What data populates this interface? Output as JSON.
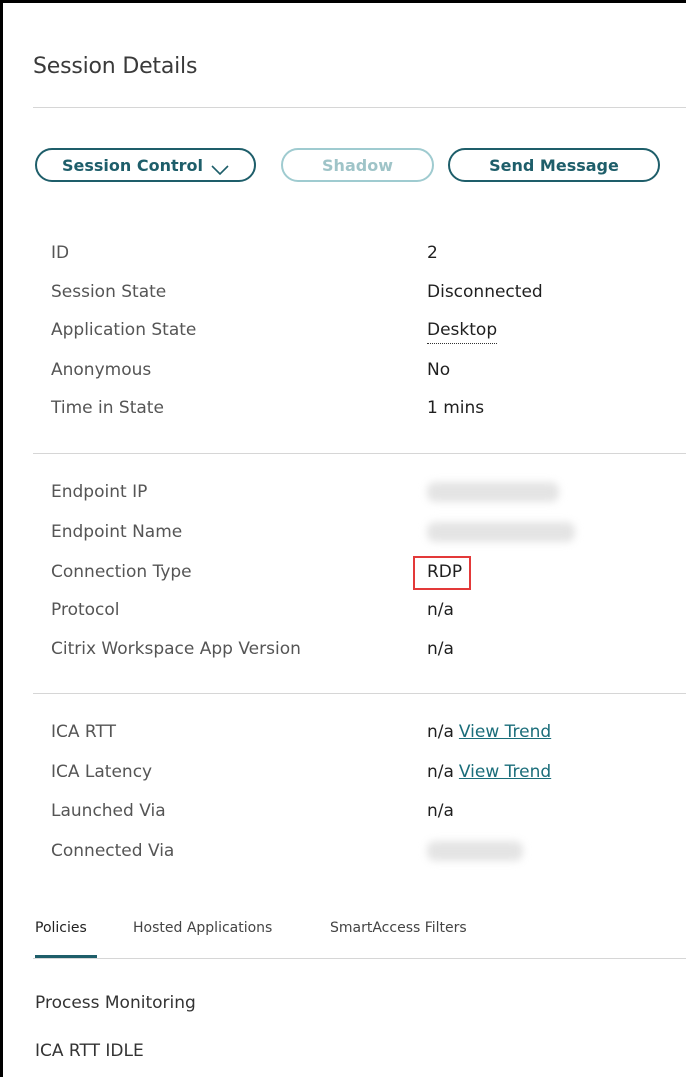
{
  "panel": {
    "title": "Session Details"
  },
  "actions": {
    "session_control_label": "Session Control",
    "shadow_label": "Shadow",
    "send_message_label": "Send Message"
  },
  "session_info": [
    {
      "label": "ID",
      "value": "2"
    },
    {
      "label": "Session State",
      "value": "Disconnected"
    },
    {
      "label": "Application State",
      "value": "Desktop"
    },
    {
      "label": "Anonymous",
      "value": "No"
    },
    {
      "label": "Time in State",
      "value": "1 mins"
    }
  ],
  "connection_info": [
    {
      "label": "Endpoint IP",
      "value": ""
    },
    {
      "label": "Endpoint Name",
      "value": ""
    },
    {
      "label": "Connection Type",
      "value": "RDP"
    },
    {
      "label": "Protocol",
      "value": "n/a"
    },
    {
      "label": "Citrix Workspace App Version",
      "value": "n/a"
    }
  ],
  "metrics_info": [
    {
      "label": "ICA RTT",
      "value": "n/a",
      "link": "View Trend"
    },
    {
      "label": "ICA Latency",
      "value": "n/a",
      "link": "View Trend"
    },
    {
      "label": "Launched Via",
      "value": "n/a"
    },
    {
      "label": "Connected Via",
      "value": ""
    }
  ],
  "tabs": [
    {
      "label": "Policies",
      "active": true
    },
    {
      "label": "Hosted Applications",
      "active": false
    },
    {
      "label": "SmartAccess Filters",
      "active": false
    }
  ],
  "policies": [
    {
      "label": "Process Monitoring"
    },
    {
      "label": "ICA RTT IDLE"
    }
  ],
  "colors": {
    "accent": "#1e5e6a",
    "accent_disabled": "#9fcbd0",
    "highlight": "#e33939",
    "link": "#1a6d7a"
  },
  "icons": {
    "session_control_chevron": "chevron-down-icon"
  }
}
